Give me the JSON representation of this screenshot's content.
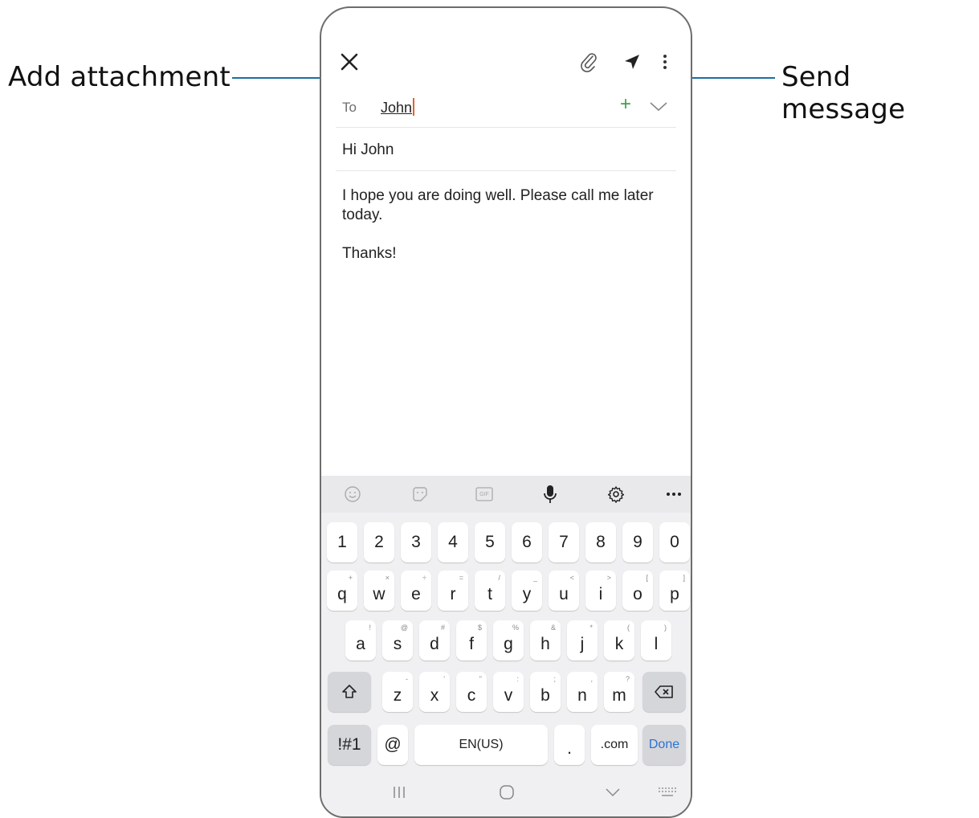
{
  "callouts": {
    "attachment_label": "Add attachment",
    "send_label": "Send message"
  },
  "colors": {
    "callout_line": "#1a6fa3",
    "add_recipient": "#3aa34a",
    "caret": "#e0642a",
    "done": "#2a73d6"
  },
  "compose": {
    "to_label": "To",
    "to_value": "John",
    "add_recipient_symbol": "+",
    "subject": "Hi John",
    "body_lines": [
      "I hope you are doing well. Please call me later",
      "today."
    ],
    "signoff": "Thanks!"
  },
  "keyboard": {
    "toolbar_icons": [
      "emoji-icon",
      "sticker-icon",
      "gif-icon",
      "microphone-icon",
      "settings-icon",
      "more-icon"
    ],
    "gif_label": "GIF",
    "number_row": [
      "1",
      "2",
      "3",
      "4",
      "5",
      "6",
      "7",
      "8",
      "9",
      "0"
    ],
    "row1": [
      {
        "key": "q",
        "sub": "+"
      },
      {
        "key": "w",
        "sub": "×"
      },
      {
        "key": "e",
        "sub": "÷"
      },
      {
        "key": "r",
        "sub": "="
      },
      {
        "key": "t",
        "sub": "/"
      },
      {
        "key": "y",
        "sub": "_"
      },
      {
        "key": "u",
        "sub": "<"
      },
      {
        "key": "i",
        "sub": ">"
      },
      {
        "key": "o",
        "sub": "["
      },
      {
        "key": "p",
        "sub": "]"
      }
    ],
    "row2": [
      {
        "key": "a",
        "sub": "!"
      },
      {
        "key": "s",
        "sub": "@"
      },
      {
        "key": "d",
        "sub": "#"
      },
      {
        "key": "f",
        "sub": "$"
      },
      {
        "key": "g",
        "sub": "%"
      },
      {
        "key": "h",
        "sub": "&"
      },
      {
        "key": "j",
        "sub": "*"
      },
      {
        "key": "k",
        "sub": "("
      },
      {
        "key": "l",
        "sub": ")"
      }
    ],
    "row3": [
      {
        "key": "z",
        "sub": "-"
      },
      {
        "key": "x",
        "sub": "'"
      },
      {
        "key": "c",
        "sub": "\""
      },
      {
        "key": "v",
        "sub": ":"
      },
      {
        "key": "b",
        "sub": ";"
      },
      {
        "key": "n",
        "sub": ","
      },
      {
        "key": "m",
        "sub": "?"
      }
    ],
    "bottom": {
      "symbols": "!#1",
      "at": "@",
      "space": "EN(US)",
      "period": ".",
      "dotcom": ".com",
      "done": "Done"
    }
  }
}
